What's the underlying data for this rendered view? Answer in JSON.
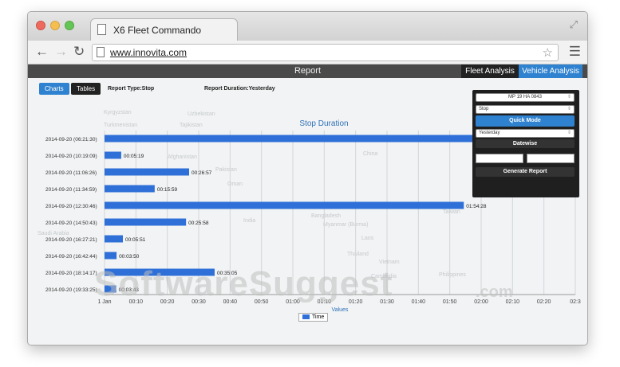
{
  "browser": {
    "tab_title": "X6 Fleet Commando",
    "url": "www.innovita.com"
  },
  "app": {
    "title": "Report",
    "tabs": [
      "Fleet Analysis",
      "Vehicle Analysis"
    ],
    "view_buttons": [
      "Charts",
      "Tables"
    ],
    "report_type": "Report Type:Stop",
    "report_duration": "Report Duration:Yesterday"
  },
  "panel": {
    "vehicle": "MP 19 HA 0843",
    "report_type": "Stop",
    "quick_mode_label": "Quick Mode",
    "duration": "Yesterday",
    "datewise_label": "Datewise",
    "generate_label": "Generate Report"
  },
  "map_labels": [
    "Kyrgyzstan",
    "Turkmenistan",
    "Tajikistan",
    "Afghanistan",
    "Pakistan",
    "Oman",
    "India",
    "Nepal",
    "China",
    "Bangladesh",
    "Myanmar (Burma)",
    "Laos",
    "Thailand",
    "Vietnam",
    "Cambodia",
    "Philippines",
    "Taiwan",
    "Saudi Arabia",
    "Uzbekistan"
  ],
  "watermark": "SoftwareSuggest",
  "watermark_suffix": ".com",
  "colors": {
    "accent": "#2f82cf",
    "bar": "#2f70d8",
    "appbar": "#4a4a4a",
    "panel": "#1f1f1f"
  },
  "chart_data": {
    "type": "bar",
    "orientation": "horizontal",
    "title": "Stop Duration",
    "xlabel": "Values",
    "ylabel": "",
    "legend": [
      "Time"
    ],
    "legend_position": "bottom",
    "grid": true,
    "x_ticks": [
      "1 Jan",
      "00:10",
      "00:20",
      "00:30",
      "00:40",
      "00:50",
      "01:00",
      "01:10",
      "01:20",
      "01:30",
      "01:40",
      "01:50",
      "02:00",
      "02:10",
      "02:20",
      "02:3"
    ],
    "xlim_minutes": [
      0,
      150
    ],
    "categories": [
      "2014-09-20 (06:21:30)",
      "2014-09-20 (10:19:09)",
      "2014-09-20 (11:06:26)",
      "2014-09-20 (11:34:59)",
      "2014-09-20 (12:30:46)",
      "2014-09-20 (14:50:43)",
      "2014-09-20 (16:27:21)",
      "2014-09-20 (16:42:44)",
      "2014-09-20 (18:14:17)",
      "2014-09-20 (19:33:25)"
    ],
    "series": [
      {
        "name": "Time",
        "values_minutes": [
          135,
          5.32,
          26.95,
          15.98,
          114.47,
          25.97,
          5.85,
          3.83,
          35.08,
          3.72
        ],
        "labels": [
          "",
          "00:05:19",
          "00:26:57",
          "00:15:59",
          "01:54:28",
          "00:25:58",
          "00:05:51",
          "00:03:50",
          "00:35:05",
          "00:03:43"
        ]
      }
    ]
  }
}
